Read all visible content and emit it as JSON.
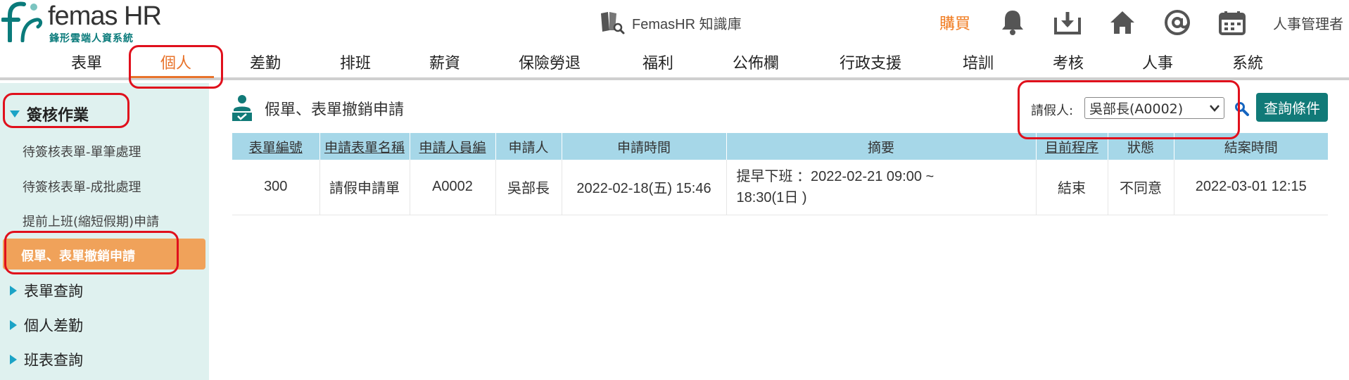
{
  "header": {
    "logo_title": "femas HR",
    "logo_subtitle": "鋒形雲端人資系統",
    "knowledge_base": "FemasHR 知識庫",
    "buy_label": "購買",
    "admin_label": "人事管理者",
    "icons": [
      "bell-icon",
      "download-icon",
      "home-icon",
      "at-icon",
      "calendar-icon"
    ]
  },
  "nav": {
    "items": [
      "表單",
      "個人",
      "差勤",
      "排班",
      "薪資",
      "保險勞退",
      "福利",
      "公佈欄",
      "行政支援",
      "培訓",
      "考核",
      "人事",
      "系統"
    ],
    "active_index": 1
  },
  "sidebar": {
    "group_open": "簽核作業",
    "items": [
      "待簽核表單-單筆處理",
      "待簽核表單-成批處理",
      "提前上班(縮短假期)申請",
      "假單、表單撤銷申請"
    ],
    "active_item": "假單、表單撤銷申請",
    "groups_closed": [
      "表單查詢",
      "個人差勤",
      "班表查詢"
    ]
  },
  "main": {
    "title": "假單、表單撤銷申請",
    "filter_label": "請假人:",
    "filter_value": "吳部長(A0002)",
    "query_button": "查詢條件"
  },
  "table": {
    "columns": [
      "表單編號",
      "申請表單名稱",
      "申請人員編",
      "申請人",
      "申請時間",
      "摘要",
      "目前程序",
      "狀態",
      "結案時間"
    ],
    "rows": [
      {
        "form_no": "300",
        "form_name": "請假申請單",
        "emp_no": "A0002",
        "applicant": "吳部長",
        "apply_time": "2022-02-18(五) 15:46",
        "summary_line1": "提早下班 ：2022-02-21 09:00 ~",
        "summary_line2": "18:30(1日 )",
        "stage": "結束",
        "status": "不同意",
        "close_time": "2022-03-01 12:15"
      }
    ]
  },
  "colors": {
    "accent_orange": "#e8732b",
    "teal": "#117a78",
    "header_blue": "#a6d7e8",
    "sidebar_bg": "#dff1ef",
    "annotation_red": "#e0101c"
  }
}
